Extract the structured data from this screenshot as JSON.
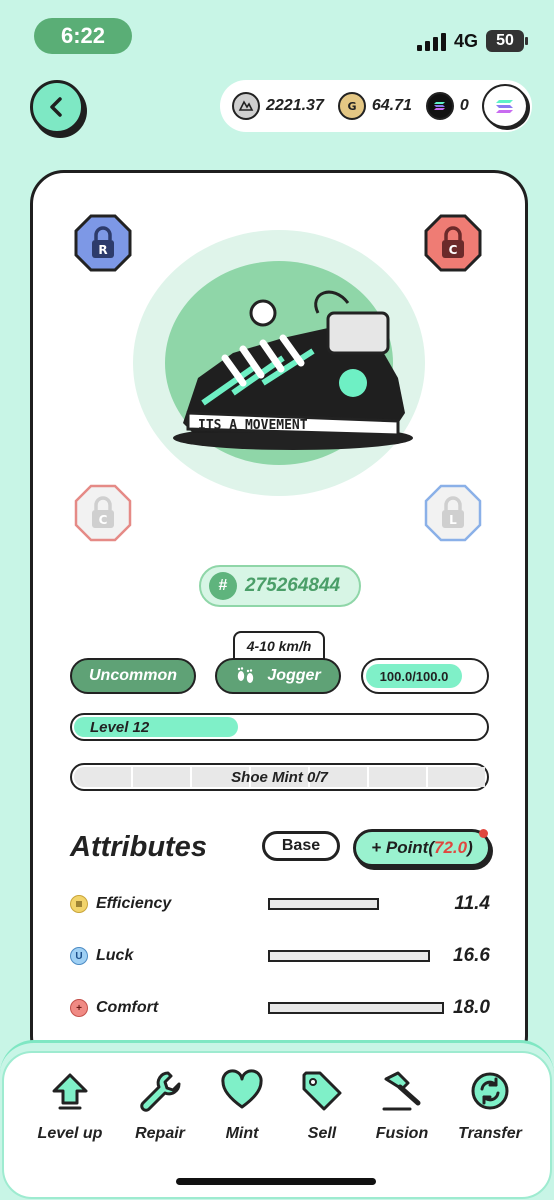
{
  "status": {
    "time": "6:22",
    "network": "4G",
    "battery": "50"
  },
  "wallet": {
    "gst": "2221.37",
    "gmt": "64.71",
    "sol": "0"
  },
  "gems": {
    "top_left": "R",
    "top_right": "C",
    "bottom_left": "C",
    "bottom_right": "L"
  },
  "shoe": {
    "id_prefix": "#",
    "id": "275264844",
    "speed": "4-10 km/h",
    "rarity": "Uncommon",
    "type": "Jogger",
    "durability": "100.0/100.0",
    "level": "Level 12",
    "level_progress": 0.4,
    "mint": "Shoe Mint 0/7",
    "art_text": "ITS A MOVEMENT"
  },
  "attributes": {
    "title": "Attributes",
    "base_label": "Base",
    "point_prefix": "+ Point(",
    "point_value": "72.0",
    "point_suffix": ")",
    "items": [
      {
        "name": "Efficiency",
        "value": "11.4",
        "icon": "efficiency-icon",
        "color": "#f2d46b"
      },
      {
        "name": "Luck",
        "value": "16.6",
        "icon": "luck-icon",
        "color": "#9fd0f4"
      },
      {
        "name": "Comfort",
        "value": "18.0",
        "icon": "comfort-icon",
        "color": "#f08a84"
      }
    ]
  },
  "toolbar": {
    "level_up": "Level up",
    "repair": "Repair",
    "mint": "Mint",
    "sell": "Sell",
    "fusion": "Fusion",
    "transfer": "Transfer"
  },
  "colors": {
    "accent": "#7ff0c8",
    "dark_green": "#5fa276",
    "background": "#c8f5e6"
  }
}
